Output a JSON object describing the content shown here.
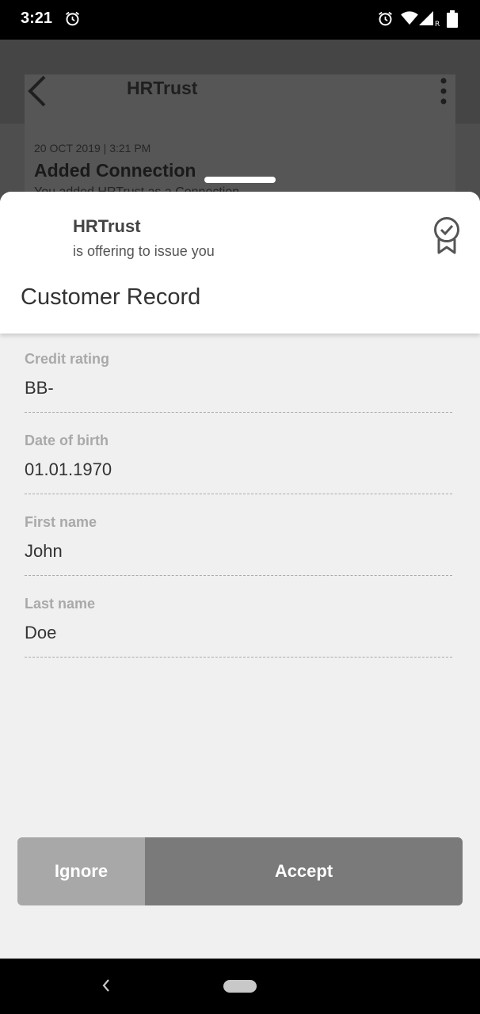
{
  "status_bar": {
    "time": "3:21"
  },
  "background": {
    "app_title": "HRTrust",
    "event_date": "20 OCT 2019 | 3:21 PM",
    "event_title": "Added Connection",
    "event_desc": "You added HRTrust as a Connection"
  },
  "sheet": {
    "issuer": "HRTrust",
    "subtitle": "is offering to issue you",
    "record_title": "Customer Record",
    "fields": [
      {
        "label": "Credit rating",
        "value": "BB-"
      },
      {
        "label": "Date of birth",
        "value": "01.01.1970"
      },
      {
        "label": "First name",
        "value": "John"
      },
      {
        "label": "Last name",
        "value": "Doe"
      }
    ],
    "ignore_label": "Ignore",
    "accept_label": "Accept"
  },
  "colors": {
    "accent_button": "#7a7a7a",
    "secondary_button": "#a8a8a8",
    "label_gray": "#a9a9a9"
  },
  "icons": [
    "alarm-icon",
    "wifi-icon",
    "signal-icon",
    "battery-icon",
    "back-arrow-icon",
    "more-vert-icon",
    "certificate-badge-icon",
    "nav-back-icon",
    "nav-home-pill"
  ]
}
